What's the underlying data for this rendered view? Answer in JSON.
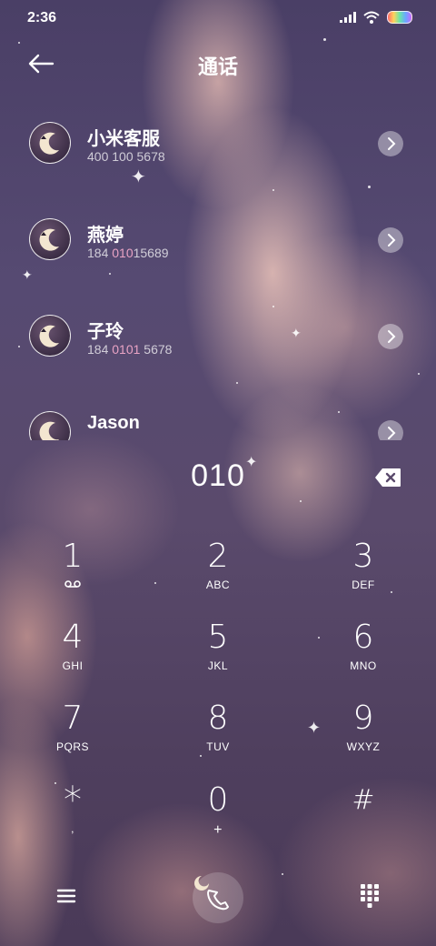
{
  "status_bar": {
    "time": "2:36",
    "icons": [
      "signal-icon",
      "wifi-icon",
      "battery-icon"
    ]
  },
  "app_bar": {
    "title": "通话",
    "back_icon": "back-arrow-icon"
  },
  "search_results": [
    {
      "name": "小米客服",
      "number_prefix": "",
      "number_match": "400 100 5678",
      "number_suffix": ""
    },
    {
      "name": "燕婷",
      "number_prefix": "184 ",
      "number_match": "010",
      "number_suffix": "15689"
    },
    {
      "name": "子玲",
      "number_prefix": "184 ",
      "number_match": "0101",
      "number_suffix": " 5678"
    },
    {
      "name": "Jason",
      "number_prefix": "",
      "number_match": "",
      "number_suffix": ""
    }
  ],
  "dialer": {
    "entered_number": "010",
    "backspace_icon": "backspace-icon"
  },
  "keypad": [
    {
      "digit": "1",
      "letters": "",
      "icon": "voicemail-icon"
    },
    {
      "digit": "2",
      "letters": "ABC"
    },
    {
      "digit": "3",
      "letters": "DEF"
    },
    {
      "digit": "4",
      "letters": "GHI"
    },
    {
      "digit": "5",
      "letters": "JKL"
    },
    {
      "digit": "6",
      "letters": "MNO"
    },
    {
      "digit": "7",
      "letters": "PQRS"
    },
    {
      "digit": "8",
      "letters": "TUV"
    },
    {
      "digit": "9",
      "letters": "WXYZ"
    },
    {
      "digit": "*",
      "letters": ","
    },
    {
      "digit": "0",
      "letters": "+"
    },
    {
      "digit": "#",
      "letters": ""
    }
  ],
  "bottom_bar": {
    "menu_icon": "hamburger-menu-icon",
    "call_icon": "phone-icon",
    "keypad_icon": "dialpad-icon"
  },
  "colors": {
    "match_highlight": "#e9a3c4",
    "background_top": "#4a3f66",
    "cloud": "#ecc4ba"
  }
}
